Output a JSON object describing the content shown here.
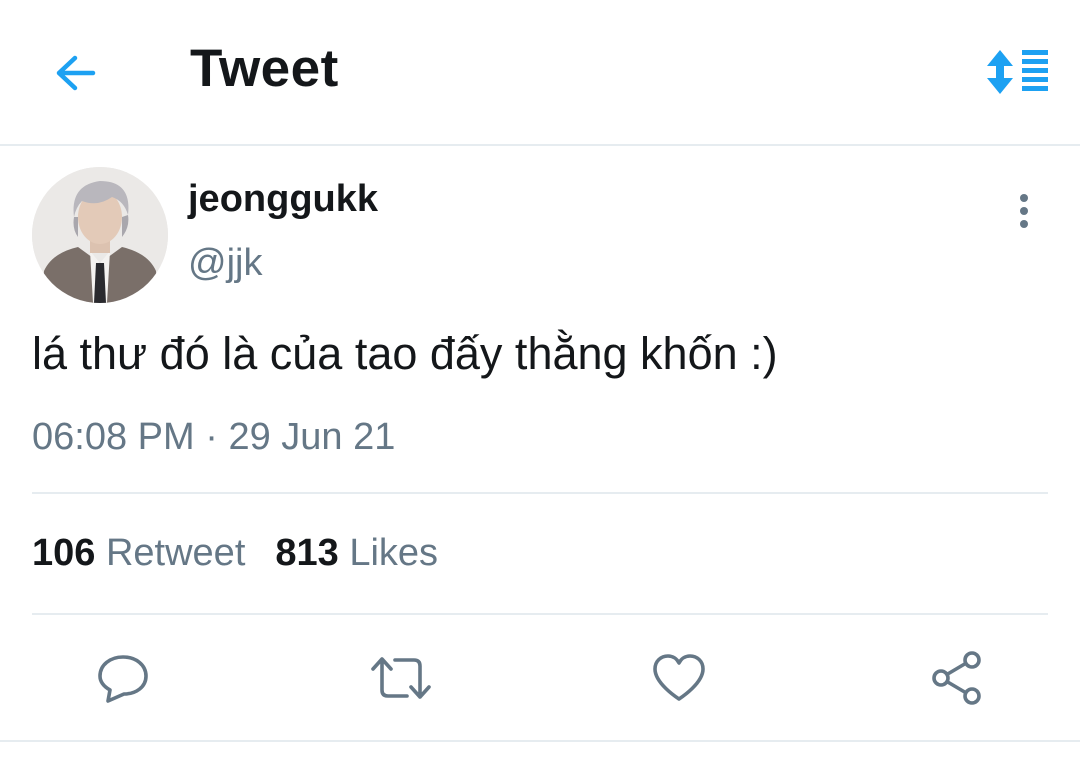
{
  "header": {
    "title": "Tweet",
    "back_icon": "arrow-left-icon",
    "sort_icon": "sort-icon"
  },
  "tweet": {
    "display_name": "jeonggukk",
    "handle": "@jjk",
    "text": "lá thư đó là của tao đấy thằng khốn :)",
    "time": "06:08 PM",
    "separator": "·",
    "date": "29 Jun 21",
    "more_icon": "more-vertical-icon"
  },
  "stats": {
    "retweets_count": "106",
    "retweets_label": "Retweet",
    "likes_count": "813",
    "likes_label": "Likes"
  },
  "actions": [
    {
      "name": "reply",
      "icon": "reply-icon"
    },
    {
      "name": "retweet",
      "icon": "retweet-icon"
    },
    {
      "name": "like",
      "icon": "heart-icon"
    },
    {
      "name": "share",
      "icon": "share-icon"
    }
  ],
  "colors": {
    "accent": "#1da1f2",
    "text_primary": "#14171a",
    "text_secondary": "#657786",
    "divider": "#e6ecf0"
  }
}
